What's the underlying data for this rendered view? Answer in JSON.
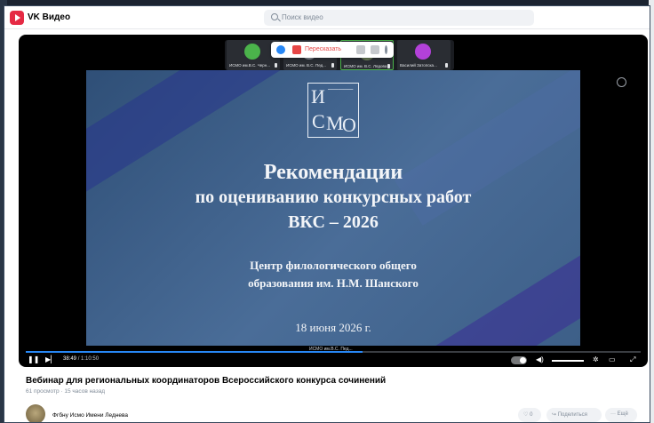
{
  "header": {
    "app_title": "VK Видео",
    "search_placeholder": "Поиск видео"
  },
  "call": {
    "participants": [
      {
        "name": "ИСМО им.В.С. Черн...",
        "avatar_color": "#4bb34b"
      },
      {
        "name": "ИСМО им. В.С. Пед...",
        "avatar_color": "#8a9099"
      },
      {
        "name": "ИСМО им. В.С. Лядова",
        "avatar_color": "#6a7c58"
      },
      {
        "name": "Василий Затопска...",
        "avatar_color": "#b341d9"
      }
    ],
    "share_label": "Пересказать",
    "presenter_caption": "ИСМО им.В.С. Пед..."
  },
  "slide": {
    "logo_letters": "ИСМО",
    "title_line1": "Рекомендации",
    "title_line2": "по оцениванию конкурсных работ",
    "title_line3": "ВКС – 2026",
    "subtitle_line1": "Центр филологического общего",
    "subtitle_line2": "образования им. Н.М. Шанского",
    "date": "18 июня 2026 г."
  },
  "player": {
    "current_time": "38:49",
    "duration": "1:10:50",
    "progress_fraction": 0.548
  },
  "video": {
    "title": "Вебинар для региональных координаторов Всероссийского конкурса сочинений",
    "meta": "61 просмотр · 15 часов назад"
  },
  "channel": {
    "name": "Фгбну Исмо Имени Леднева"
  },
  "actions": {
    "likes": "0",
    "share": "Поделиться",
    "more": "Ещё"
  },
  "colors": {
    "accent": "#2787f5",
    "vk_red": "#e52a44"
  }
}
